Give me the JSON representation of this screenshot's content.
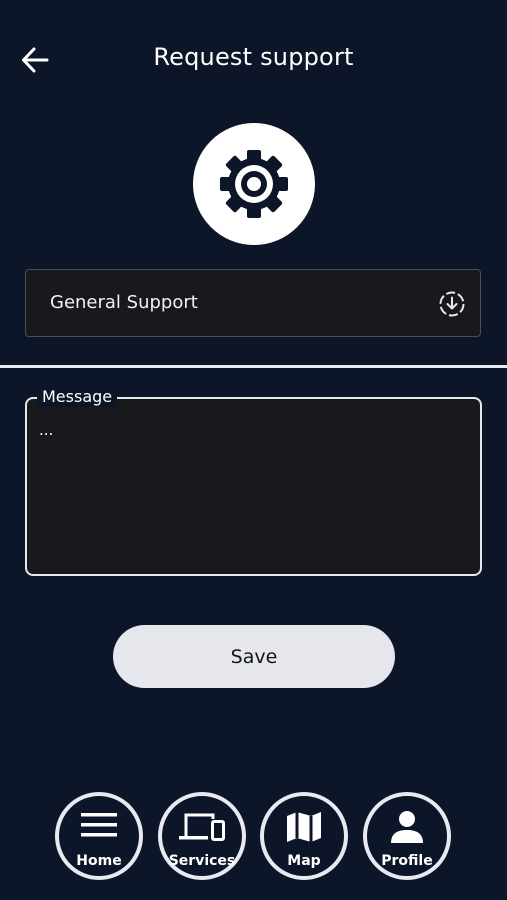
{
  "header": {
    "title": "Request support",
    "back_icon": "arrow-left-icon"
  },
  "hero": {
    "icon": "gear-icon"
  },
  "category": {
    "selected": "General Support",
    "icon": "circle-arrow-down-icon"
  },
  "message": {
    "label": "Message",
    "value": "..."
  },
  "save": {
    "label": "Save"
  },
  "nav": {
    "items": [
      {
        "label": "Home",
        "icon": "menu-icon"
      },
      {
        "label": "Services",
        "icon": "devices-icon"
      },
      {
        "label": "Map",
        "icon": "map-icon"
      },
      {
        "label": "Profile",
        "icon": "person-icon"
      }
    ]
  },
  "colors": {
    "background": "#0d1528",
    "field": "#17191c",
    "light": "#e5e7ec"
  }
}
